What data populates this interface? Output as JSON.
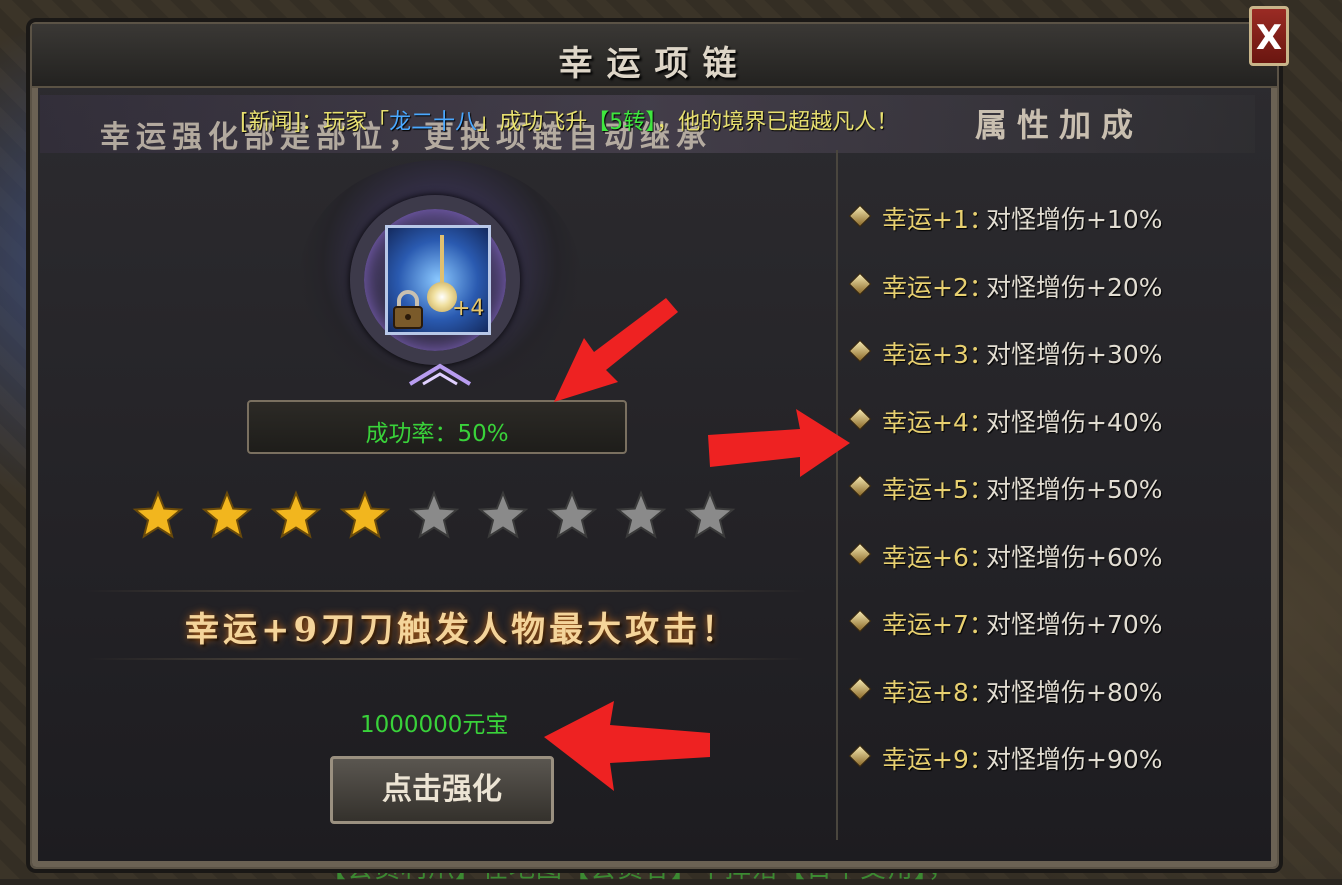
{
  "window": {
    "title": "幸运项链",
    "close_label": "X"
  },
  "header": {
    "left_title": "幸运强化部是部位，更换项链自动继承",
    "right_title": "属性加成"
  },
  "news": {
    "prefix": "[新闻]：玩家「",
    "player": "龙二十八",
    "middle": "」成功飞升",
    "rank": "【5转】",
    "suffix": "，他的境界已超越凡人！"
  },
  "item": {
    "name_icon": "necklace-icon",
    "locked": true,
    "plus_level": "+4"
  },
  "success_rate": "成功率：50%",
  "stars": {
    "filled": 4,
    "total": 9,
    "filled_color": "#f2b61e",
    "empty_color": "#8a8a8a"
  },
  "slogan": "幸运+9刀刀触发人物最大攻击！",
  "cost": "1000000元宝",
  "strengthen_button": "点击强化",
  "bonuses": [
    {
      "label": "幸运+1：",
      "value": "对怪增伤+10%"
    },
    {
      "label": "幸运+2：",
      "value": "对怪增伤+20%"
    },
    {
      "label": "幸运+3：",
      "value": "对怪增伤+30%"
    },
    {
      "label": "幸运+4：",
      "value": "对怪增伤+40%"
    },
    {
      "label": "幸运+5：",
      "value": "对怪增伤+50%"
    },
    {
      "label": "幸运+6：",
      "value": "对怪增伤+60%"
    },
    {
      "label": "幸运+7：",
      "value": "对怪增伤+70%"
    },
    {
      "label": "幸运+8：",
      "value": "对怪增伤+80%"
    },
    {
      "label": "幸运+9：",
      "value": "对怪增伤+90%"
    }
  ],
  "background_text": "【会员利爪】在地图【会员谷】中掉落【日华交角】，",
  "colors": {
    "accent_green": "#39d23a",
    "label_gold": "#e8d070",
    "arrow_red": "#ee2222"
  }
}
